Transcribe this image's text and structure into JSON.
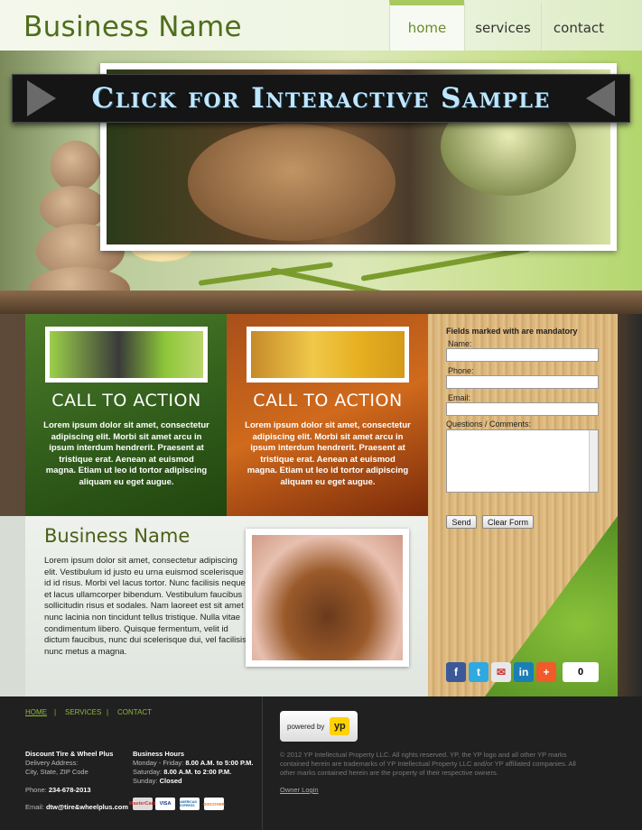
{
  "header": {
    "logo": "Business Name",
    "nav": [
      {
        "label": "home",
        "active": true
      },
      {
        "label": "services",
        "active": false
      },
      {
        "label": "contact",
        "active": false
      }
    ]
  },
  "banner": {
    "text": "Click for Interactive Sample"
  },
  "cta_boxes": [
    {
      "title": "CALL TO ACTION",
      "body": "Lorem ipsum dolor sit amet, consectetur adipiscing elit. Morbi sit amet arcu in ipsum interdum hendrerit. Praesent at tristique erat. Aenean at euismod magna. Etiam ut leo id tortor adipiscing aliquam eu eget augue."
    },
    {
      "title": "CALL TO ACTION",
      "body": "Lorem ipsum dolor sit amet, consectetur adipiscing elit. Morbi sit amet arcu in ipsum interdum hendrerit. Praesent at tristique erat. Aenean at euismod magna. Etiam ut leo id tortor adipiscing aliquam eu eget augue."
    }
  ],
  "form": {
    "mandatory_note": "Fields marked with   are mandatory",
    "name_label": "Name:",
    "phone_label": "Phone:",
    "email_label": "Email:",
    "questions_label": "Questions / Comments:",
    "send_label": "Send",
    "clear_label": "Clear Form"
  },
  "social": {
    "count": "0",
    "icons": [
      "facebook-icon",
      "twitter-icon",
      "email-icon",
      "linkedin-icon",
      "addthis-icon"
    ]
  },
  "content": {
    "title": "Business Name",
    "body": "Lorem ipsum dolor sit amet, consectetur adipiscing elit. Vestibulum id justo eu urna euismod scelerisque id id risus. Morbi vel lacus tortor. Nunc facilisis neque et lacus ullamcorper bibendum. Vestibulum faucibus sollicitudin risus et sodales. Nam laoreet est sit amet nunc lacinia non tincidunt tellus tristique. Nulla vitae condimentum libero. Quisque fermentum, velit id dictum faucibus, nunc dui scelerisque dui, vel facilisis nunc metus a magna."
  },
  "footer": {
    "links": [
      "HOME",
      "SERVICES",
      "CONTACT"
    ],
    "separator": "|",
    "company": "Discount Tire & Wheel Plus",
    "address_label": "Delivery Address:",
    "city": "City, State, ZIP Code",
    "phone_label": "Phone:",
    "phone": "234-678-2013",
    "email_label": "Email:",
    "email": "dtw@tire&wheelplus.com",
    "hours_title": "Business Hours",
    "hours1_label": "Monday - Friday:",
    "hours1": "8.00 A.M. to 5:00 P.M.",
    "hours2_label": "Saturday:",
    "hours2": "8.00 A.M. to 2:00 P.M.",
    "hours3_label": "Sunday:",
    "hours3": "Closed",
    "cards": [
      "MasterCard",
      "VISA",
      "AMERICAN EXPRESS",
      "DISCOVER"
    ],
    "powered_by": "powered by",
    "yp": "yp",
    "copyright": "© 2012  YP Intellectual Property LLC. All rights reserved. YP, the YP logo and all other YP marks contained herein are trademarks of YP Intellectual Property LLC and/or YP affiliated companies. All other marks contained herein are the property of their respective owners.",
    "owner_login": "Owner Login"
  }
}
